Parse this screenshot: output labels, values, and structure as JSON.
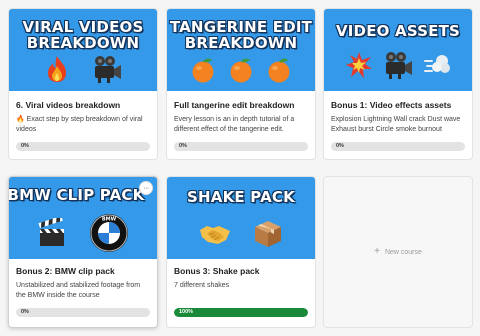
{
  "courses": [
    {
      "thumb_title_1": "VIRAL VIDEOS",
      "thumb_title_2": "BREAKDOWN",
      "icons": [
        "fire-icon",
        "movie-camera-icon"
      ],
      "title": "6. Viral videos breakdown",
      "description": "🔥 Exact step by step breakdown of viral videos",
      "progress_label": "0%",
      "progress": 0
    },
    {
      "thumb_title_1": "TANGERINE EDIT",
      "thumb_title_2": "BREAKDOWN",
      "icons": [
        "tangerine-icon",
        "tangerine-icon",
        "tangerine-icon"
      ],
      "title": "Full tangerine edit breakdown",
      "description": "Every lesson is an in depth tutorial of a different effect of the tangerine edit.",
      "progress_label": "0%",
      "progress": 0
    },
    {
      "thumb_title_1": "VIDEO ASSETS",
      "thumb_title_2": "",
      "icons": [
        "collision-icon",
        "movie-camera-icon",
        "dash-smoke-icon"
      ],
      "title": "Bonus 1: Video effects assets",
      "description": "Explosion Lightning Wall crack Dust wave Exhaust burst Circle smoke burnout",
      "progress_label": "0%",
      "progress": 0
    },
    {
      "thumb_title_1": "BMW CLIP PACK",
      "thumb_title_2": "",
      "icons": [
        "clapper-board-icon",
        "bmw-logo-icon"
      ],
      "logo_text": "BMW",
      "title": "Bonus 2: BMW clip pack",
      "description": "Unstabilized and stabilized footage from the BMW inside the course",
      "progress_label": "0%",
      "progress": 0
    },
    {
      "thumb_title_1": "SHAKE PACK",
      "thumb_title_2": "",
      "icons": [
        "handshake-icon",
        "package-icon"
      ],
      "title": "Bonus 3: Shake pack",
      "description": "7 different shakes",
      "progress_label": "100%",
      "progress": 1
    }
  ],
  "new_course": {
    "plus": "+",
    "label": "New course"
  },
  "more_button_label": "···",
  "colors": {
    "thumb_bg": "#3399e8",
    "progress_full": "#1a8a3a",
    "progress_track": "#e3e3e3"
  }
}
